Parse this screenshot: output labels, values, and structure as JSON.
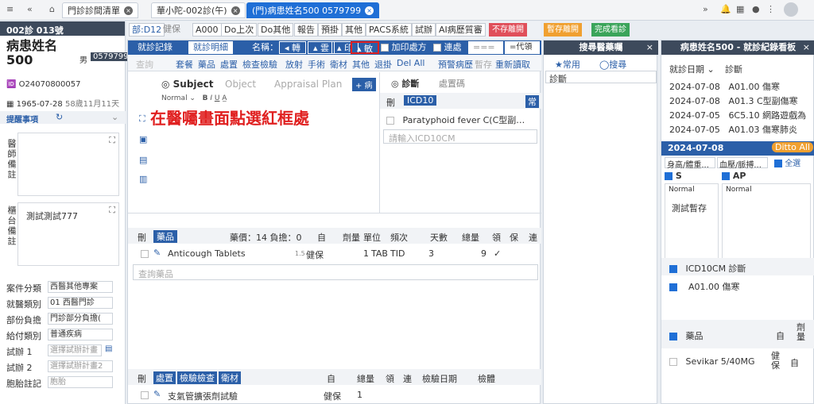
{
  "topbar": {
    "tabs": [
      "門診診間清單",
      "華小陀-002診(午)",
      "(門)病患姓名500 0579799"
    ]
  },
  "patient": {
    "title": "002診 013號",
    "name1": "病患姓名",
    "name2": "500",
    "sex": "男",
    "id": "0579799",
    "code": "O24070800057",
    "dob": "1965-07-28",
    "age": "58歲11月11天",
    "notes_label": "提醒事項",
    "doctor_note_label": "醫師備註",
    "counter_label": "櫃台備註",
    "counter_note": "測試測試777"
  },
  "fields": [
    {
      "label": "案件分類",
      "value": "西醫其他專案"
    },
    {
      "label": "就醫類別",
      "value": "01 西醫門診"
    },
    {
      "label": "部份負擔",
      "value": "門診部分負擔("
    },
    {
      "label": "給付類別",
      "value": "普通疾病"
    },
    {
      "label": "試辦 1",
      "value": "選擇試辦計畫"
    },
    {
      "label": "試辦 2",
      "value": "選擇試辦計畫2"
    },
    {
      "label": "胞胎註記",
      "value": "胞胎"
    }
  ],
  "toolbar": {
    "items": [
      "部:D12",
      "健保",
      "A000",
      "Do上次",
      "Do其他",
      "報告",
      "預掛",
      "其他",
      "PACS系統",
      "試辦",
      "AI病歷質審",
      "不存離開",
      "暫存離開",
      "完成看診"
    ]
  },
  "center": {
    "tabs": [
      "就診記錄",
      "就診明細"
    ],
    "name_label": "名稱：",
    "btns": [
      "轉",
      "雲",
      "印",
      "敏"
    ],
    "add_rx": "加印處方",
    "cont": "連處",
    "code_prefix": "=代領=",
    "row2": [
      "套餐",
      "藥品",
      "處置",
      "檢查檢驗",
      "放射",
      "手術",
      "衛材",
      "其他",
      "退掛",
      "Del All",
      "預警病歷",
      "暫存",
      "重新讀取"
    ],
    "search_ph": "查詢",
    "soap_tabs": [
      "Subject",
      "Object",
      "Appraisal Plan"
    ],
    "annot": "在醫囑畫面點選紅框處",
    "dx_tabs": [
      "診斷",
      "處置碼"
    ],
    "icd_head": "ICD10",
    "icd_common": "常",
    "dx_item": "Paratyphoid fever C(C型副…",
    "icd_ph": "請輸入ICD10CM",
    "drug_head": {
      "del": "刪",
      "title": "藥品",
      "price": "藥價：14 負擔：0",
      "self": "自",
      "cols": [
        "劑量",
        "單位",
        "頻次",
        "天數",
        "總量",
        "領",
        "保",
        "連"
      ]
    },
    "drug_row": {
      "name": "Anticough Tablets",
      "sub": "1.5",
      "ins": "健保",
      "dose": "1",
      "unit": "TAB",
      "freq": "TID",
      "days": "3",
      "total": "9",
      "check": "✓"
    },
    "drug_ph": "查詢藥品",
    "proc_head": {
      "del": "刪",
      "tags": [
        "處置",
        "檢驗檢查",
        "衛材"
      ],
      "self": "自",
      "cols": [
        "總量",
        "領",
        "連",
        "檢驗日期",
        "檢體"
      ]
    },
    "proc_row": {
      "name": "支氣管擴張劑試驗",
      "ins": "健保",
      "total": "1"
    }
  },
  "search_panel": {
    "title": "搜尋醫藥囑",
    "tabs": [
      "★常用",
      "◯搜尋"
    ],
    "dx": "診斷"
  },
  "history": {
    "title": "病患姓名500 - 就診紀錄看板",
    "cols": [
      "就診日期",
      "診斷"
    ],
    "rows": [
      {
        "date": "2024-07-08",
        "dx": "A01.00 傷寒"
      },
      {
        "date": "2024-07-08",
        "dx": "A01.3 C型副傷寒"
      },
      {
        "date": "2024-07-05",
        "dx": "6C5.10 網路遊戲為"
      },
      {
        "date": "2024-07-05",
        "dx": "A01.03 傷寒肺炎"
      }
    ],
    "sel_date": "2024-07-08",
    "ditto": "Ditto All",
    "vitals": [
      "身高/體重...",
      "血壓/脈搏..."
    ],
    "select_all": "全選",
    "s_label": "S",
    "ap_label": "AP",
    "normal": "Normal",
    "s_text": "測試暫存",
    "icd_label": "ICD10CM 診斷",
    "icd_item": "A01.00 傷寒",
    "drug_label": "藥品",
    "self": "自",
    "dose": "劑量",
    "drug_item": "Sevikar 5/40MG",
    "drug_ins": "健保",
    "drug_self": "自"
  }
}
